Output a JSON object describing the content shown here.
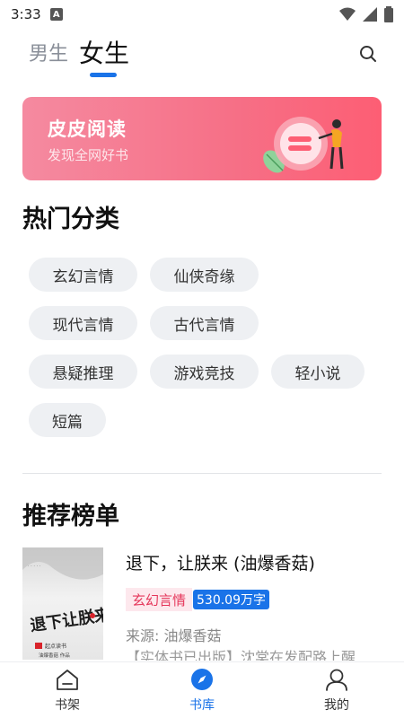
{
  "status_bar": {
    "time": "3:33",
    "notification_letter": "A"
  },
  "tabs": [
    {
      "label": "男生",
      "active": false
    },
    {
      "label": "女生",
      "active": true
    }
  ],
  "banner": {
    "title": "皮皮阅读",
    "subtitle": "发现全网好书"
  },
  "hot_categories": {
    "title": "热门分类",
    "items": [
      "玄幻言情",
      "仙侠奇缘",
      "现代言情",
      "古代言情",
      "悬疑推理",
      "游戏竞技",
      "轻小说",
      "短篇"
    ]
  },
  "ranking": {
    "title": "推荐榜单",
    "book": {
      "title": "退下，让朕来 (油爆香菇)",
      "genre": "玄幻言情",
      "word_count": "530.09万字",
      "source": "来源: 油爆香菇",
      "description": "【实体书已出版】沈棠在发配路上醒",
      "cover_title": "退下让朕来",
      "cover_publisher": "起点读书",
      "cover_author": "油爆香菇 作品"
    }
  },
  "bottom_nav": [
    {
      "label": "书架",
      "icon": "bookshelf-icon",
      "active": false
    },
    {
      "label": "书库",
      "icon": "compass-icon",
      "active": true
    },
    {
      "label": "我的",
      "icon": "user-icon",
      "active": false
    }
  ],
  "colors": {
    "accent": "#1a73e8",
    "banner_pink": "#f66f86",
    "genre_tag": "#e5365a",
    "chip_bg": "#eef0f3"
  }
}
